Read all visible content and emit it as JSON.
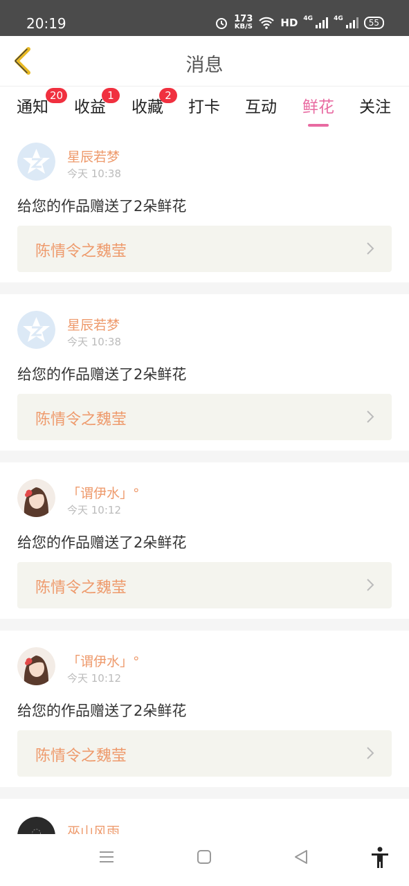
{
  "status_bar": {
    "time": "20:19",
    "net_speed": "173",
    "net_unit": "KB/S",
    "hd": "HD",
    "network_1": "4G",
    "network_2": "4G",
    "battery": "55"
  },
  "header": {
    "title": "消息"
  },
  "tabs": [
    {
      "label": "通知",
      "badge": "20"
    },
    {
      "label": "收益",
      "badge": "1"
    },
    {
      "label": "收藏",
      "badge": "2"
    },
    {
      "label": "打卡",
      "badge": ""
    },
    {
      "label": "互动",
      "badge": ""
    },
    {
      "label": "鲜花",
      "badge": ""
    },
    {
      "label": "关注",
      "badge": ""
    }
  ],
  "active_tab": "鲜花",
  "messages": [
    {
      "user": "星辰若梦",
      "time": "今天 10:38",
      "text": "给您的作品赠送了2朵鲜花",
      "work": "陈情令之魏莹",
      "avatar": "default-star-avatar"
    },
    {
      "user": "星辰若梦",
      "time": "今天 10:38",
      "text": "给您的作品赠送了2朵鲜花",
      "work": "陈情令之魏莹",
      "avatar": "default-star-avatar"
    },
    {
      "user": "「谓伊水」°",
      "time": "今天 10:12",
      "text": "给您的作品赠送了2朵鲜花",
      "work": "陈情令之魏莹",
      "avatar": "anime-girl-avatar"
    },
    {
      "user": "「谓伊水」°",
      "time": "今天 10:12",
      "text": "给您的作品赠送了2朵鲜花",
      "work": "陈情令之魏莹",
      "avatar": "anime-girl-avatar"
    }
  ],
  "partial_message": {
    "user": "巫山风雨",
    "avatar": "dark-avatar"
  },
  "colors": {
    "accent": "#e86aa1",
    "name": "#ee9a6c",
    "badge": "#f0303f",
    "back_arrow": "#e8b923"
  }
}
